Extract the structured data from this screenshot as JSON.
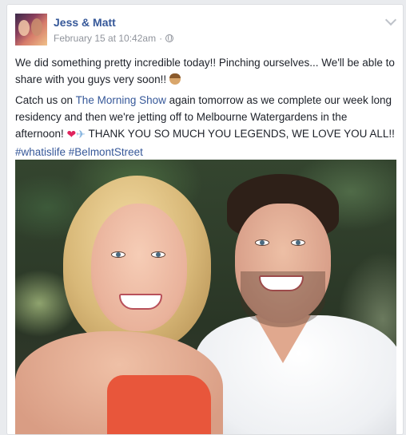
{
  "post": {
    "page_name": "Jess & Matt",
    "timestamp": "February 15 at 10:42am",
    "separator": "·",
    "audience_icon": "globe-icon",
    "menu_icon": "chevron-down-icon",
    "paragraph1": "We did something pretty incredible today!! Pinching ourselves... We'll be able to share with you guys very soon!!",
    "paragraph2_before_link": "Catch us on ",
    "paragraph2_link": "The Morning Show",
    "paragraph2_after_link": " again tomorrow as we complete our week long residency and then we're jetting off to Melbourne Watergardens in the afternoon! ",
    "paragraph2_emoji_heart": "❤",
    "paragraph2_emoji_plane": "✈",
    "paragraph2_caps": " THANK YOU SO MUCH YOU LEGENDS, WE LOVE YOU ALL!! ",
    "hashtag1": "#whatislife",
    "hashtag2": "#BelmontStreet"
  },
  "colors": {
    "link": "#365899",
    "text": "#1d2129",
    "meta": "#90949c",
    "background": "#e9ebee"
  }
}
